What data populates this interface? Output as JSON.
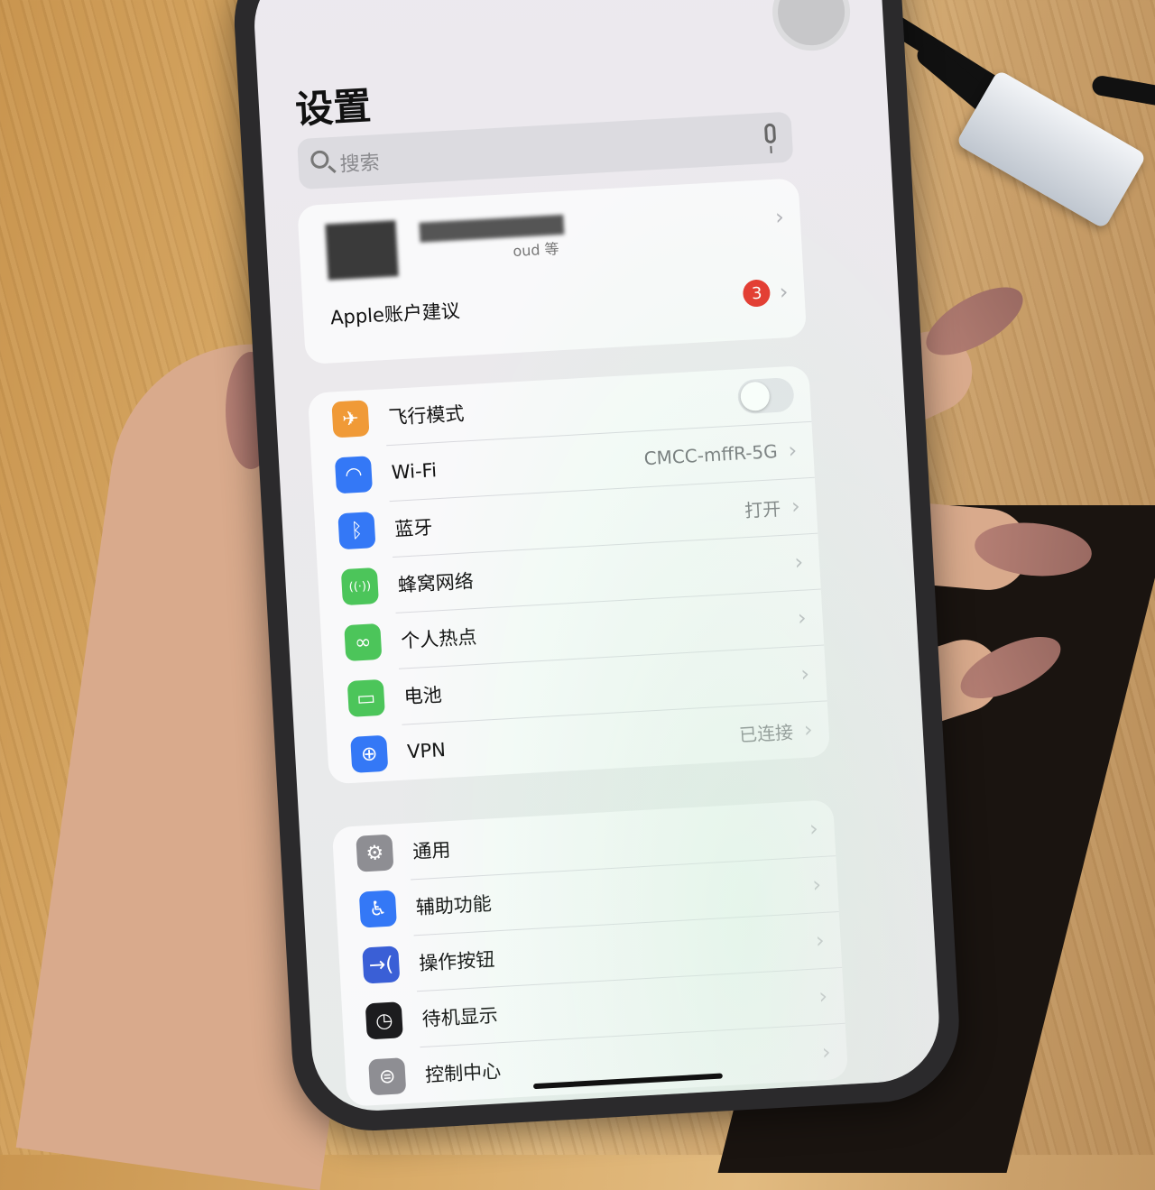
{
  "header": {
    "title": "设置"
  },
  "search": {
    "placeholder": "搜索"
  },
  "account": {
    "subtitle_fragment": "oud 等",
    "suggestions_label": "Apple账户建议",
    "suggestions_badge": "3"
  },
  "connectivity": [
    {
      "key": "airplane",
      "label": "飞行模式",
      "icon": "airplane-icon",
      "color": "#f09a37",
      "glyph": "✈",
      "toggle": false
    },
    {
      "key": "wifi",
      "label": "Wi-Fi",
      "icon": "wifi-icon",
      "color": "#3478f6",
      "glyph": "◠",
      "value": "CMCC-mffR-5G"
    },
    {
      "key": "bluetooth",
      "label": "蓝牙",
      "icon": "bluetooth-icon",
      "color": "#3478f6",
      "glyph": "ᛒ",
      "value": "打开"
    },
    {
      "key": "cellular",
      "label": "蜂窝网络",
      "icon": "cellular-icon",
      "color": "#4cc55a",
      "glyph": "((·))"
    },
    {
      "key": "hotspot",
      "label": "个人热点",
      "icon": "hotspot-icon",
      "color": "#4cc55a",
      "glyph": "∞"
    },
    {
      "key": "battery",
      "label": "电池",
      "icon": "battery-icon",
      "color": "#4cc55a",
      "glyph": "▭"
    },
    {
      "key": "vpn",
      "label": "VPN",
      "icon": "vpn-icon",
      "color": "#3478f6",
      "glyph": "⊕",
      "value": "已连接"
    }
  ],
  "system": [
    {
      "key": "general",
      "label": "通用",
      "icon": "gear-icon",
      "color": "#8e8e93",
      "glyph": "⚙"
    },
    {
      "key": "accessibility",
      "label": "辅助功能",
      "icon": "accessibility-icon",
      "color": "#3478f6",
      "glyph": "♿"
    },
    {
      "key": "action",
      "label": "操作按钮",
      "icon": "action-button-icon",
      "color": "#3a5fd6",
      "glyph": "→("
    },
    {
      "key": "standby",
      "label": "待机显示",
      "icon": "standby-icon",
      "color": "#1c1c1e",
      "glyph": "◷"
    },
    {
      "key": "control",
      "label": "控制中心",
      "icon": "control-center-icon",
      "color": "#8e8e93",
      "glyph": "⊜"
    }
  ],
  "colors": {
    "accent": "#3478f6",
    "badge": "#e5332a"
  }
}
